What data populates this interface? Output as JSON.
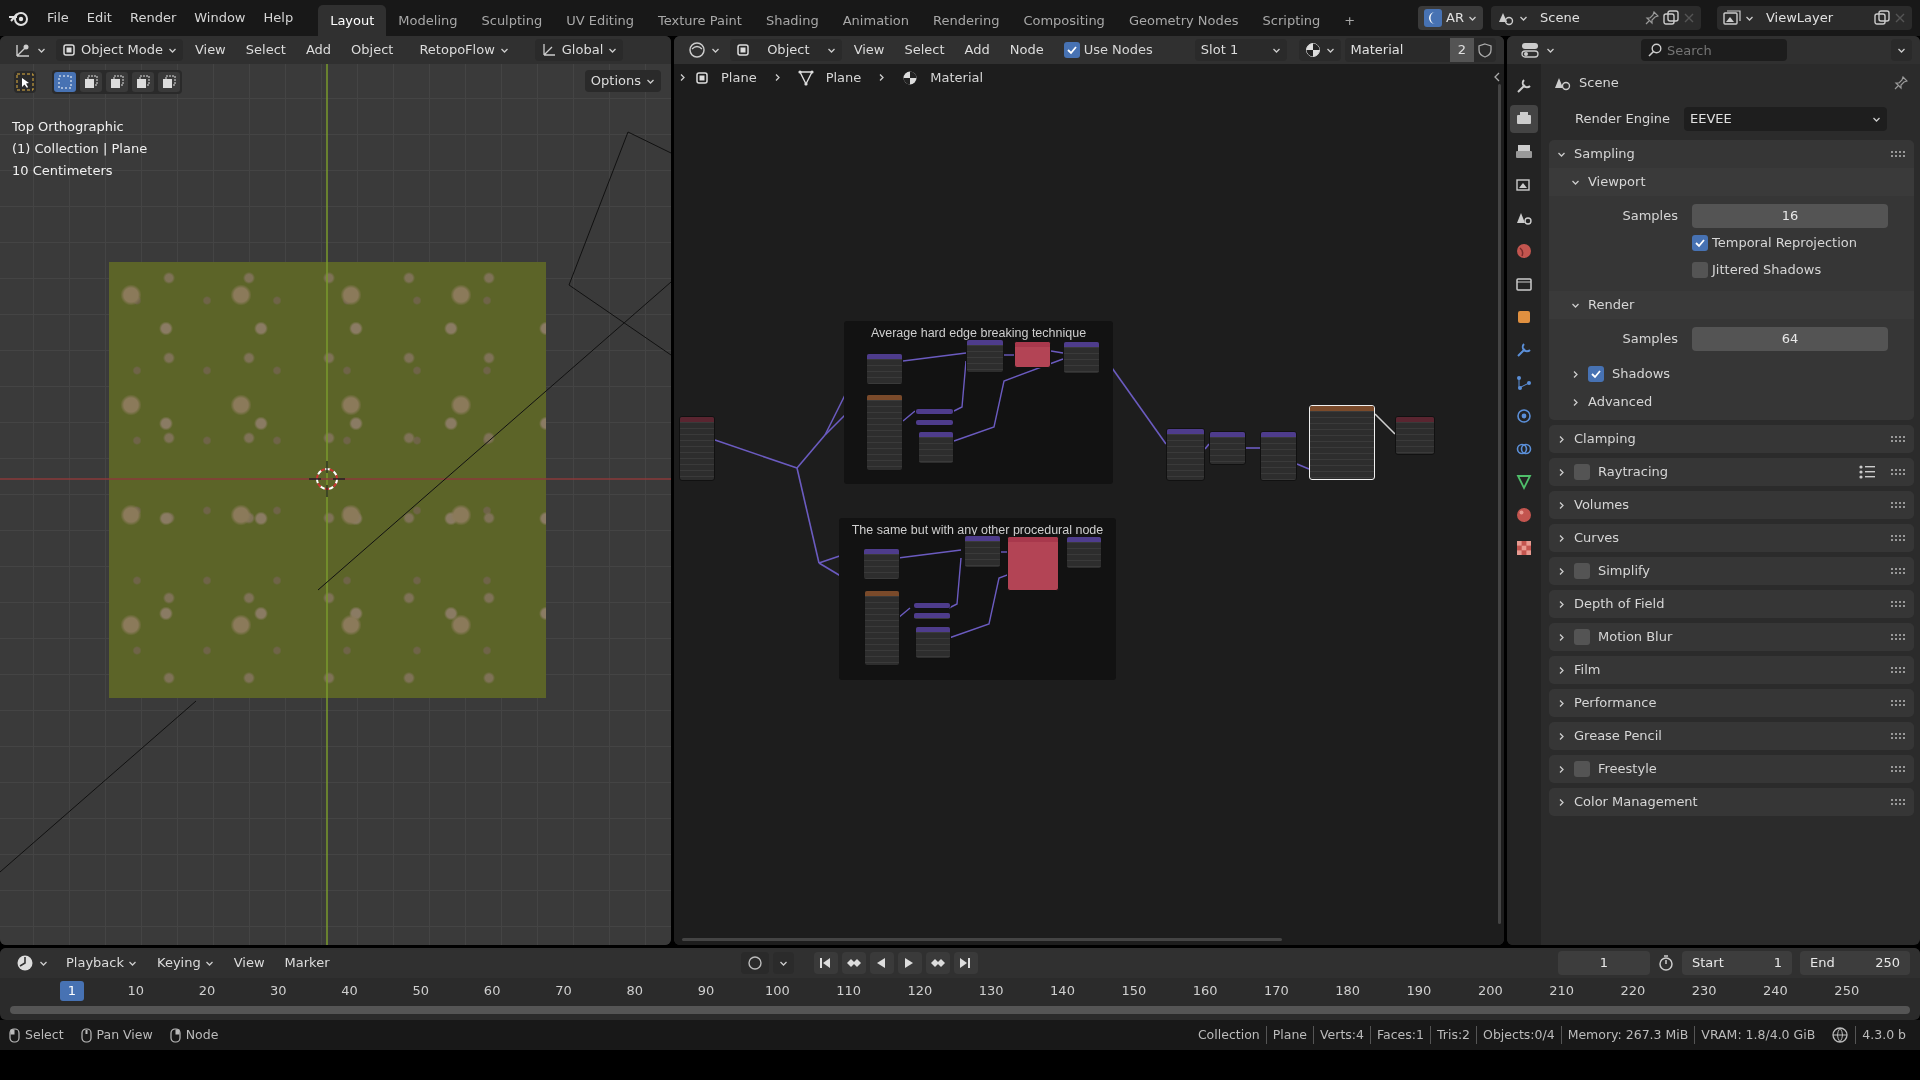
{
  "top_bar": {
    "menus": [
      "File",
      "Edit",
      "Render",
      "Window",
      "Help"
    ],
    "workspaces": [
      {
        "label": "Layout",
        "selected": true
      },
      {
        "label": "Modeling",
        "selected": false
      },
      {
        "label": "Sculpting",
        "selected": false
      },
      {
        "label": "UV Editing",
        "selected": false
      },
      {
        "label": "Texture Paint",
        "selected": false
      },
      {
        "label": "Shading",
        "selected": false
      },
      {
        "label": "Animation",
        "selected": false
      },
      {
        "label": "Rendering",
        "selected": false
      },
      {
        "label": "Compositing",
        "selected": false
      },
      {
        "label": "Geometry Nodes",
        "selected": false
      },
      {
        "label": "Scripting",
        "selected": false
      }
    ],
    "add_workspace": "+",
    "engine_menu": "AR",
    "scene": "Scene",
    "view_layer": "ViewLayer"
  },
  "viewport": {
    "mode": "Object Mode",
    "menus": [
      "View",
      "Select",
      "Add",
      "Object"
    ],
    "addon_menu": "RetopoFlow",
    "orientation": "Global",
    "options": "Options",
    "select_modes": [
      {
        "selected": true
      },
      {
        "selected": false
      },
      {
        "selected": false
      },
      {
        "selected": false
      },
      {
        "selected": false
      }
    ],
    "overlay_text": [
      "Top Orthographic",
      "(1) Collection | Plane",
      "10 Centimeters"
    ]
  },
  "node_editor": {
    "context": "Object",
    "menus": [
      "View",
      "Select",
      "Add",
      "Node"
    ],
    "use_nodes": {
      "label": "Use Nodes",
      "checked": true
    },
    "slot": "Slot 1",
    "material": "Material",
    "users": "2",
    "breadcrumbs": [
      {
        "kind": "object",
        "label": "Plane"
      },
      {
        "kind": "mesh",
        "label": "Plane"
      },
      {
        "kind": "material",
        "label": "Material"
      }
    ],
    "frames": [
      {
        "label": "Average hard edge breaking technique"
      },
      {
        "label": "The same but with any other procedural node"
      }
    ]
  },
  "properties": {
    "search": {
      "placeholder": "Search"
    },
    "context": "Scene",
    "tabs": [
      {
        "kind": "tool",
        "selected": false
      },
      {
        "kind": "render",
        "selected": true
      },
      {
        "kind": "output",
        "selected": false
      },
      {
        "kind": "view_layer",
        "selected": false
      },
      {
        "kind": "scene",
        "selected": false
      },
      {
        "kind": "world",
        "selected": false
      },
      {
        "kind": "collection",
        "selected": false
      },
      {
        "kind": "object",
        "selected": false
      },
      {
        "kind": "modifiers",
        "selected": false
      },
      {
        "kind": "particles",
        "selected": false
      },
      {
        "kind": "physics",
        "selected": false
      },
      {
        "kind": "constraints",
        "selected": false
      },
      {
        "kind": "data",
        "selected": false
      },
      {
        "kind": "material",
        "selected": false
      },
      {
        "kind": "texture",
        "selected": false
      }
    ],
    "render_engine": {
      "label": "Render Engine",
      "value": "EEVEE"
    },
    "panels": [
      {
        "label": "Sampling",
        "expanded": true,
        "children": [
          {
            "label": "Viewport",
            "expanded": true,
            "rows": [
              {
                "kind": "number",
                "label": "Samples",
                "value": "16"
              },
              {
                "kind": "checkbox",
                "label": "Temporal Reprojection",
                "checked": true
              },
              {
                "kind": "checkbox",
                "label": "Jittered Shadows",
                "checked": false
              }
            ]
          },
          {
            "label": "Render",
            "expanded": true,
            "rows": [
              {
                "kind": "number",
                "label": "Samples",
                "value": "64"
              }
            ]
          },
          {
            "label": "Shadows",
            "expanded": false,
            "checked": true
          },
          {
            "label": "Advanced",
            "expanded": false
          }
        ]
      },
      {
        "label": "Clamping",
        "expanded": false
      },
      {
        "label": "Raytracing",
        "expanded": false,
        "checked": false,
        "presets": true
      },
      {
        "label": "Volumes",
        "expanded": false
      },
      {
        "label": "Curves",
        "expanded": false
      },
      {
        "label": "Simplify",
        "expanded": false,
        "checked": false
      },
      {
        "label": "Depth of Field",
        "expanded": false
      },
      {
        "label": "Motion Blur",
        "expanded": false,
        "checked": false
      },
      {
        "label": "Film",
        "expanded": false
      },
      {
        "label": "Performance",
        "expanded": false
      },
      {
        "label": "Grease Pencil",
        "expanded": false
      },
      {
        "label": "Freestyle",
        "expanded": false,
        "checked": false
      },
      {
        "label": "Color Management",
        "expanded": false
      }
    ]
  },
  "timeline": {
    "menus": [
      {
        "label": "Playback",
        "dropdown": true
      },
      {
        "label": "Keying",
        "dropdown": true
      },
      {
        "label": "View",
        "dropdown": false
      },
      {
        "label": "Marker",
        "dropdown": false
      }
    ],
    "current_frame": "1",
    "start": {
      "label": "Start",
      "value": "1"
    },
    "end": {
      "label": "End",
      "value": "250"
    },
    "playhead": "1",
    "ticks": [
      "10",
      "20",
      "30",
      "40",
      "50",
      "60",
      "70",
      "80",
      "90",
      "100",
      "110",
      "120",
      "130",
      "140",
      "150",
      "160",
      "170",
      "180",
      "190",
      "200",
      "210",
      "220",
      "230",
      "240",
      "250"
    ]
  },
  "status_bar": {
    "hints": [
      "Select",
      "Pan View",
      "Node"
    ],
    "stats": [
      "Collection",
      "Plane",
      "Verts:4",
      "Faces:1",
      "Tris:2",
      "Objects:0/4",
      "Memory: 267.3 MiB",
      "VRAM: 1.8/4.0 GiB"
    ],
    "version": "4.3.0 b"
  }
}
